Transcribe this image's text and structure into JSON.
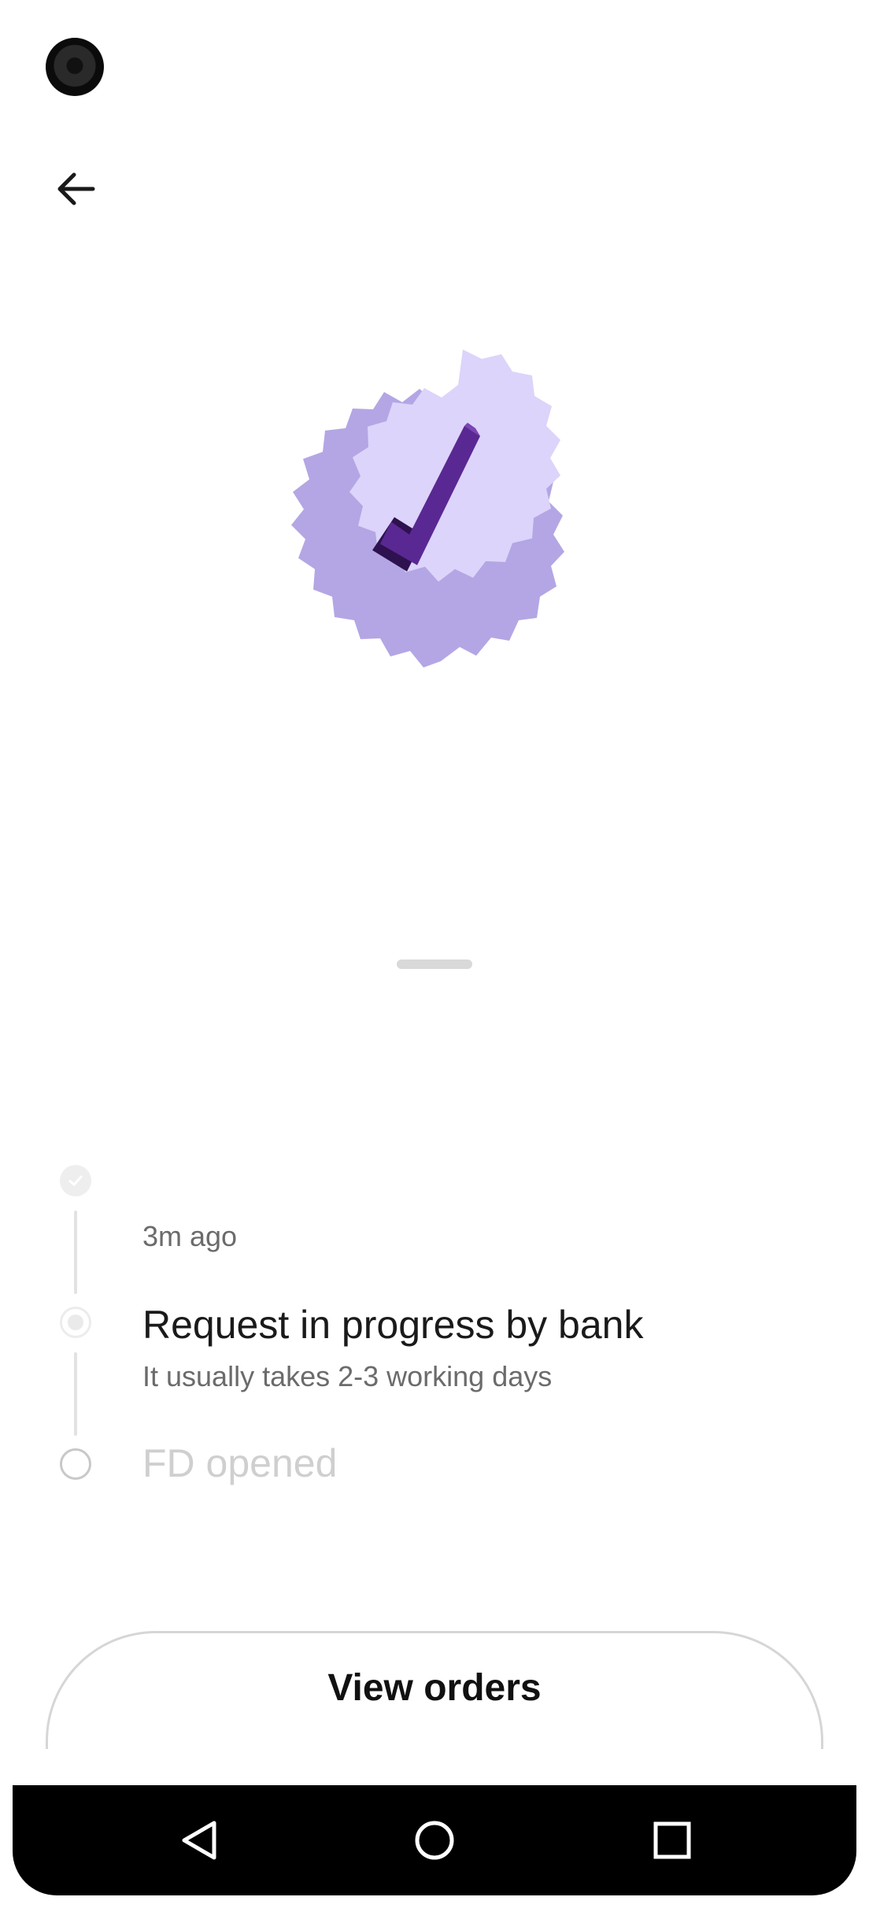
{
  "header": {
    "back_icon": "arrow-left-icon"
  },
  "hero": {
    "icon": "check-badge-icon",
    "badge_color": "#DCD4FA",
    "badge_shadow": "#B4A6E4",
    "check_color": "#5A2892"
  },
  "timeline": {
    "steps": [
      {
        "status": "done",
        "time": "3m ago",
        "icon": "check-icon"
      },
      {
        "status": "active",
        "title": "Request in progress by bank",
        "subtitle": "It usually takes 2-3 working days"
      },
      {
        "status": "pending",
        "title": "FD opened"
      }
    ]
  },
  "footer": {
    "view_orders_label": "View orders"
  },
  "navbar": {
    "back_icon": "nav-back-icon",
    "home_icon": "nav-home-icon",
    "recents_icon": "nav-recents-icon"
  }
}
